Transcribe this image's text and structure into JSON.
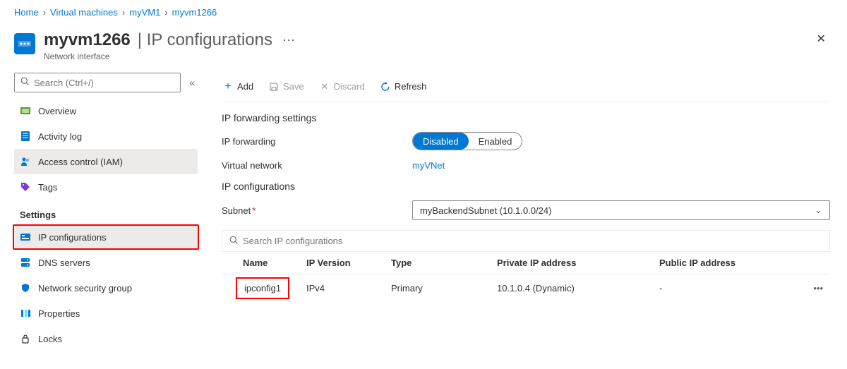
{
  "breadcrumb": {
    "items": [
      "Home",
      "Virtual machines",
      "myVM1",
      "myvm1266"
    ]
  },
  "header": {
    "title": "myvm1266",
    "suffix": "| IP configurations",
    "subtitle": "Network interface"
  },
  "sidebar": {
    "search_placeholder": "Search (Ctrl+/)",
    "items": [
      {
        "label": "Overview",
        "icon": "overview"
      },
      {
        "label": "Activity log",
        "icon": "activity"
      },
      {
        "label": "Access control (IAM)",
        "icon": "iam",
        "active": true
      },
      {
        "label": "Tags",
        "icon": "tags"
      }
    ],
    "settings_label": "Settings",
    "settings_items": [
      {
        "label": "IP configurations",
        "icon": "ip",
        "highlight": true
      },
      {
        "label": "DNS servers",
        "icon": "dns"
      },
      {
        "label": "Network security group",
        "icon": "nsg"
      },
      {
        "label": "Properties",
        "icon": "props"
      },
      {
        "label": "Locks",
        "icon": "locks"
      }
    ]
  },
  "toolbar": {
    "add": "Add",
    "save": "Save",
    "discard": "Discard",
    "refresh": "Refresh"
  },
  "main": {
    "ipfwd_section": "IP forwarding settings",
    "ipfwd_label": "IP forwarding",
    "toggle_disabled": "Disabled",
    "toggle_enabled": "Enabled",
    "vnet_label": "Virtual network",
    "vnet_value": "myVNet",
    "ipcfg_section": "IP configurations",
    "subnet_label": "Subnet",
    "subnet_value": "myBackendSubnet (10.1.0.0/24)",
    "filter_placeholder": "Search IP configurations"
  },
  "table": {
    "headers": {
      "name": "Name",
      "ipversion": "IP Version",
      "type": "Type",
      "private": "Private IP address",
      "public": "Public IP address"
    },
    "rows": [
      {
        "name": "ipconfig1",
        "ipversion": "IPv4",
        "type": "Primary",
        "private": "10.1.0.4 (Dynamic)",
        "public": "-"
      }
    ]
  }
}
